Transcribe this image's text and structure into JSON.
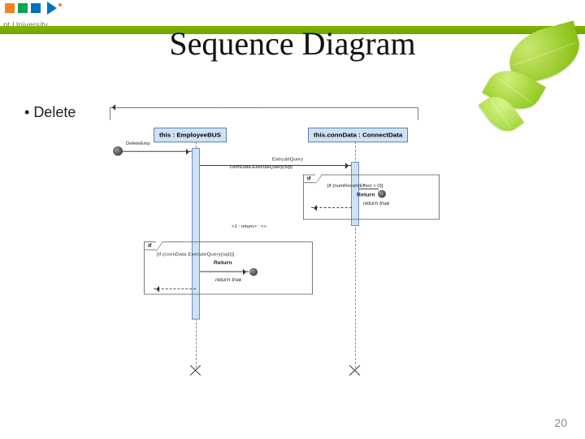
{
  "header": {
    "university_label": "pt University",
    "title": "Sequence Diagram"
  },
  "bullet": "Delete",
  "diagram": {
    "lifelines": [
      {
        "name": "this : EmployeeBUS"
      },
      {
        "name": "this.connData : ConnectData"
      }
    ],
    "messages": {
      "actor_call": "DeleteEmp",
      "execute_label": "ExecuteQuery",
      "execute_expr": "connData.ExecuteQuery(sql)",
      "frag1_label": "if",
      "frag1_guard": "[if (numRecordEffect < 0)]",
      "frag1_return_kw": "Return",
      "frag1_return_val": "return true",
      "return_to_emp": "<1 : return> : <>",
      "frag2_label": "if",
      "frag2_guard": "[if (connData.ExecuteQuery(sql))]",
      "frag2_return_kw": "Return",
      "frag2_return_val": "return true"
    }
  },
  "page": "20"
}
